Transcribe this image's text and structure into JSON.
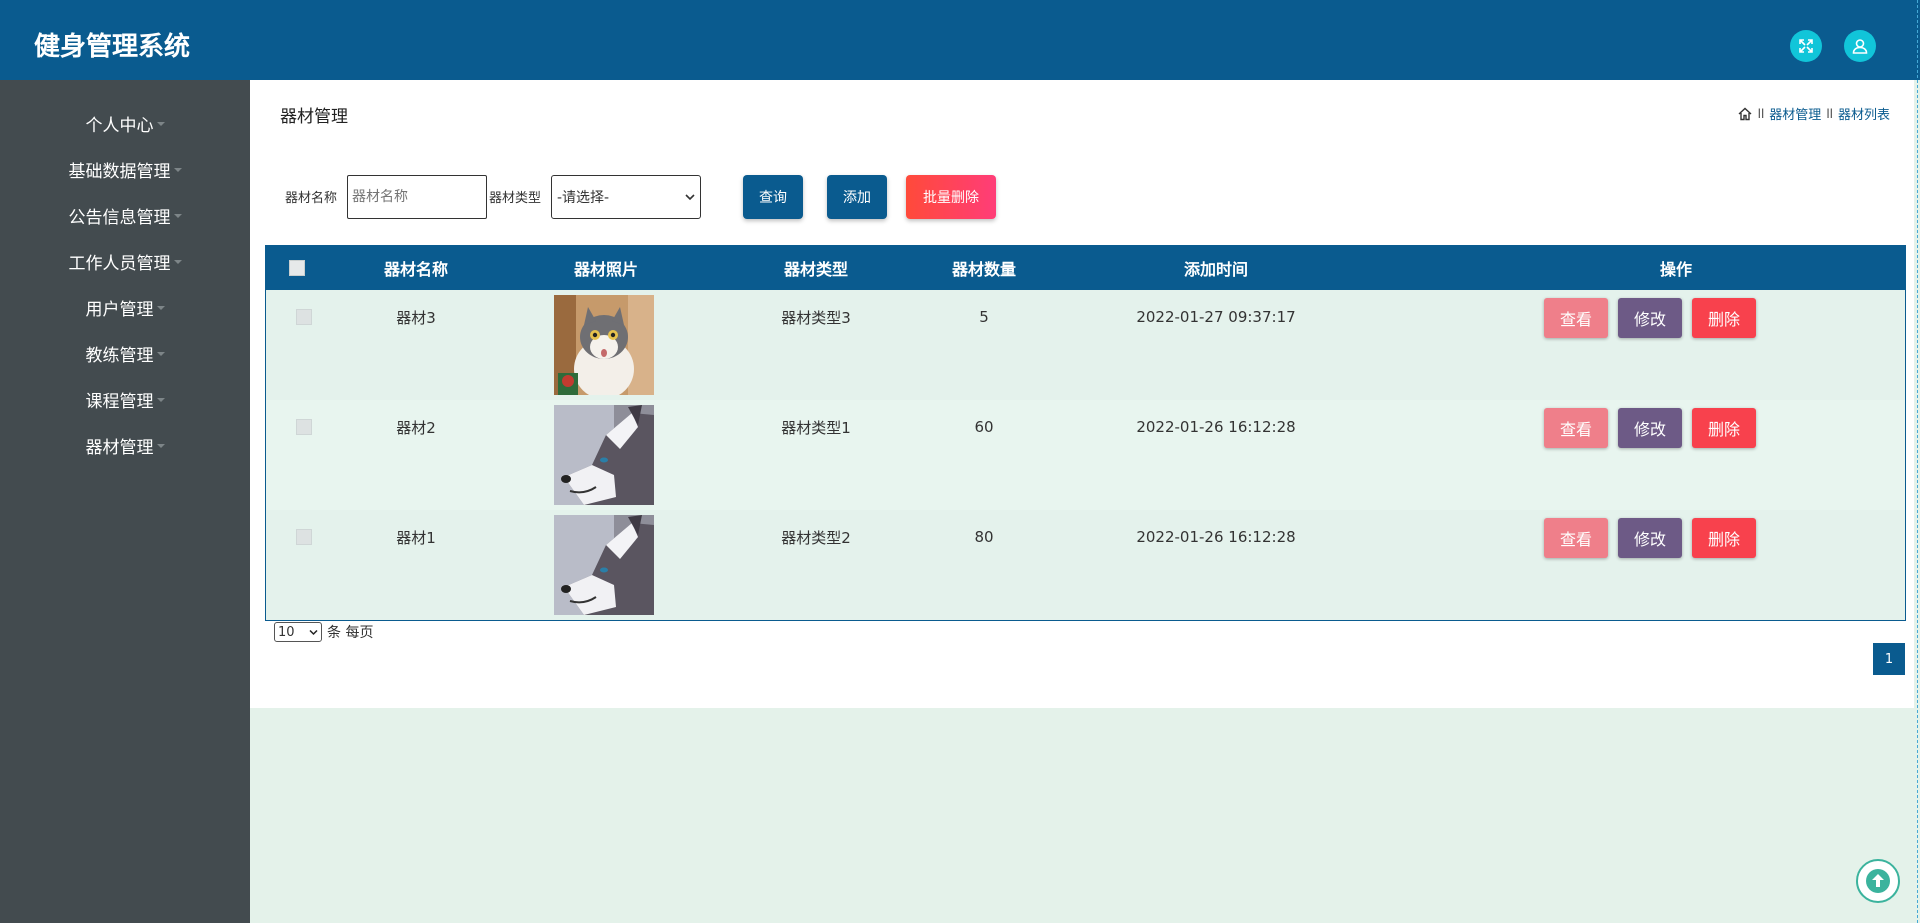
{
  "app": {
    "title": "健身管理系统"
  },
  "header_icons": [
    "fullscreen-icon",
    "user-icon"
  ],
  "sidebar": {
    "items": [
      {
        "label": "个人中心"
      },
      {
        "label": "基础数据管理"
      },
      {
        "label": "公告信息管理"
      },
      {
        "label": "工作人员管理"
      },
      {
        "label": "用户管理"
      },
      {
        "label": "教练管理"
      },
      {
        "label": "课程管理"
      },
      {
        "label": "器材管理"
      }
    ]
  },
  "page": {
    "title": "器材管理",
    "breadcrumb": {
      "sep": "ll",
      "item1": "器材管理",
      "item2": "器材列表"
    }
  },
  "search": {
    "name_label": "器材名称",
    "name_placeholder": "器材名称",
    "type_label": "器材类型",
    "type_selected": "-请选择-",
    "query_button": "查询",
    "add_button": "添加",
    "batch_delete_button": "批量删除"
  },
  "table": {
    "headers": {
      "name": "器材名称",
      "photo": "器材照片",
      "type": "器材类型",
      "quantity": "器材数量",
      "time": "添加时间",
      "actions": "操作"
    },
    "rows": [
      {
        "name": "器材3",
        "photo": "cat-photo",
        "type": "器材类型3",
        "quantity": "5",
        "time": "2022-01-27 09:37:17"
      },
      {
        "name": "器材2",
        "photo": "husky-photo",
        "type": "器材类型1",
        "quantity": "60",
        "time": "2022-01-26 16:12:28"
      },
      {
        "name": "器材1",
        "photo": "husky-photo",
        "type": "器材类型2",
        "quantity": "80",
        "time": "2022-01-26 16:12:28"
      }
    ],
    "action_labels": {
      "view": "查看",
      "edit": "修改",
      "delete": "删除"
    }
  },
  "pagination": {
    "page_size": "10",
    "page_size_suffix": "条 每页",
    "current_page": "1"
  },
  "colors": {
    "header": "#0a5b8f",
    "sidebar": "#434b4f",
    "accent_cyan": "#11c5d9",
    "view_button": "#ef7f8a",
    "edit_button": "#6d5a86",
    "delete_button": "#f8414d",
    "batch_delete_gradient": [
      "#ff4a3a",
      "#ff3d78"
    ]
  }
}
